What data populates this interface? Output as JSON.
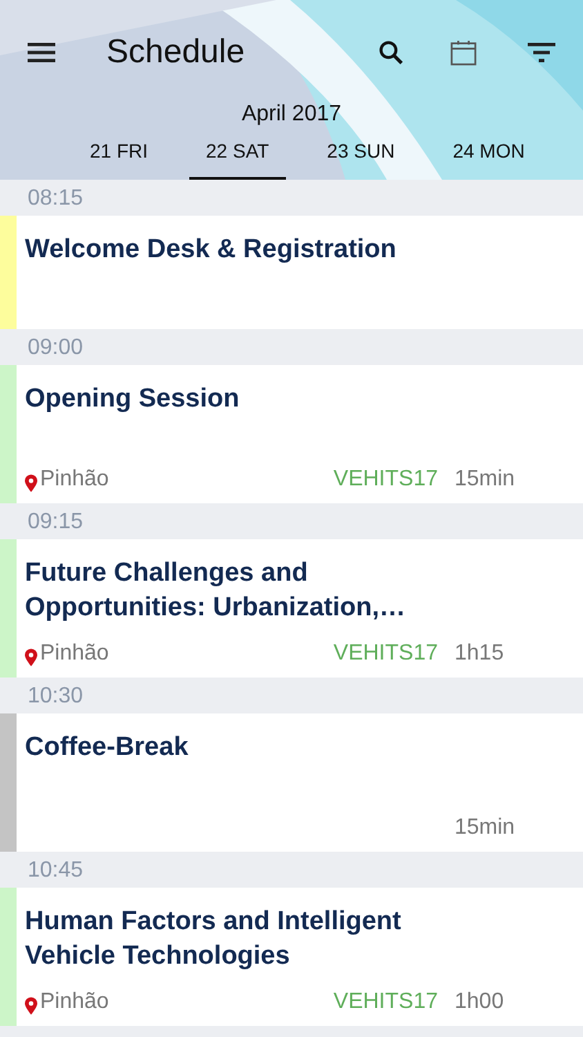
{
  "app_bar": {
    "title": "Schedule"
  },
  "month": "April 2017",
  "days": [
    {
      "label": "21 FRI",
      "selected": false
    },
    {
      "label": "22 SAT",
      "selected": true
    },
    {
      "label": "23 SUN",
      "selected": false
    },
    {
      "label": "24 MON",
      "selected": false
    }
  ],
  "sessions": [
    {
      "time": "08:15",
      "title": "Welcome Desk & Registration",
      "color": "#fdfd9c"
    },
    {
      "time": "09:00",
      "title": "Opening Session",
      "color": "#ccf5c8",
      "location": "Pinhão",
      "track": "VEHITS17",
      "duration": "15min"
    },
    {
      "time": "09:15",
      "title": "Future Challenges and Opportunities: Urbanization,…",
      "color": "#ccf5c8",
      "location": "Pinhão",
      "track": "VEHITS17",
      "duration": "1h15"
    },
    {
      "time": "10:30",
      "title": "Coffee-Break",
      "color": "#c4c4c4",
      "duration": "15min"
    },
    {
      "time": "10:45",
      "title": "Human Factors and Intelligent Vehicle Technologies",
      "color": "#ccf5c8",
      "location": "Pinhão",
      "track": "VEHITS17",
      "duration": "1h00"
    }
  ]
}
